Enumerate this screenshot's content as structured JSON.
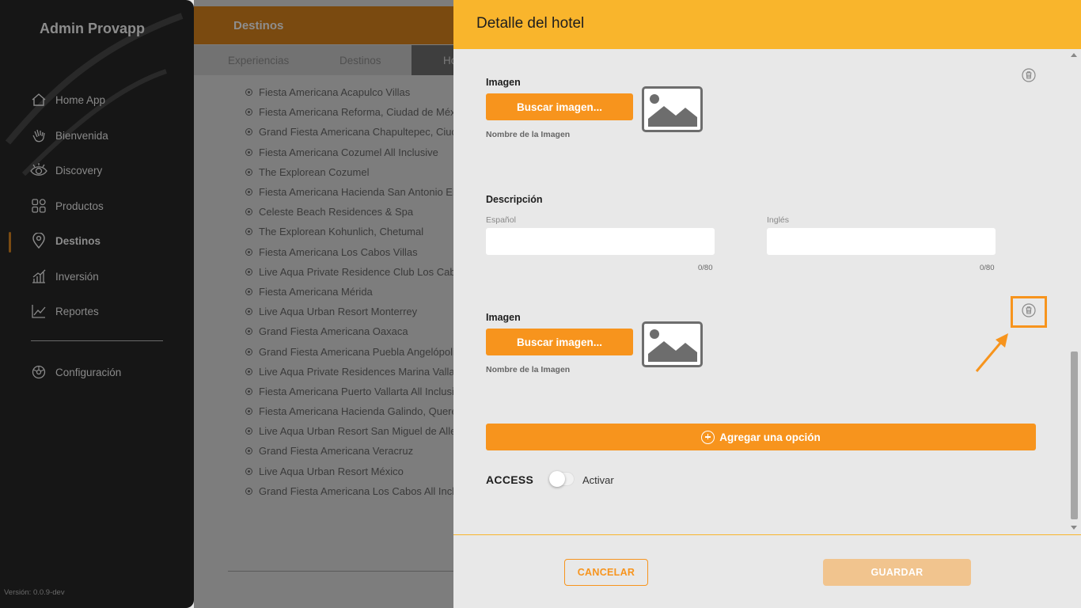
{
  "app": {
    "title": "Admin Provapp",
    "version": "Versión: 0.0.9-dev"
  },
  "sidebar": {
    "items": [
      {
        "label": "Home App",
        "icon": "home-icon"
      },
      {
        "label": "Bienvenida",
        "icon": "wave-hand-icon"
      },
      {
        "label": "Discovery",
        "icon": "eye-icon"
      },
      {
        "label": "Productos",
        "icon": "grid-icon"
      },
      {
        "label": "Destinos",
        "icon": "location-pin-icon",
        "active": true
      },
      {
        "label": "Inversión",
        "icon": "bar-chart-icon"
      },
      {
        "label": "Reportes",
        "icon": "line-chart-icon"
      }
    ],
    "settings": {
      "label": "Configuración",
      "icon": "gear-icon"
    }
  },
  "background": {
    "header_title": "Destinos",
    "tabs": [
      "Experiencias",
      "Destinos",
      "Ho"
    ],
    "hotels": [
      "Fiesta Americana Acapulco Villas",
      "Fiesta Americana Reforma, Ciudad de México",
      "Grand Fiesta Americana Chapultepec, Ciudad de México",
      "Fiesta Americana Cozumel All Inclusive",
      "The Explorean Cozumel",
      "Fiesta Americana Hacienda San Antonio El Puente",
      "Celeste Beach Residences & Spa",
      "The Explorean Kohunlich, Chetumal",
      "Fiesta Americana Los Cabos Villas",
      "Live Aqua Private Residence Club Los Cabos",
      "Fiesta Americana Mérida",
      "Live Aqua Urban Resort Monterrey",
      "Grand Fiesta Americana Oaxaca",
      "Grand Fiesta Americana Puebla Angelópolis",
      "Live Aqua Private Residences Marina Vallarta",
      "Fiesta Americana Puerto Vallarta All Inclusive",
      "Fiesta Americana Hacienda Galindo, Querétaro",
      "Live Aqua Urban Resort San Miguel de Allende",
      "Grand Fiesta Americana Veracruz",
      "Live Aqua Urban Resort México",
      "Grand Fiesta Americana Los Cabos All Inclusive"
    ]
  },
  "panel": {
    "title": "Detalle del hotel",
    "image_label": "Imagen",
    "browse_button": "Buscar imagen...",
    "image_name_caption": "Nombre de la Imagen",
    "description_label": "Descripción",
    "spanish_label": "Español",
    "english_label": "Inglés",
    "spanish_value": "",
    "english_value": "",
    "spanish_counter": "0/80",
    "english_counter": "0/80",
    "add_option": "Agregar una opción",
    "access_label": "ACCESS",
    "toggle_label": "Activar",
    "toggle_on": false,
    "cancel": "CANCELAR",
    "save": "GUARDAR"
  },
  "colors": {
    "header": "#f9b52c",
    "accent": "#f7941d",
    "save_disabled": "#f1c48e",
    "sidebar": "#161616"
  }
}
